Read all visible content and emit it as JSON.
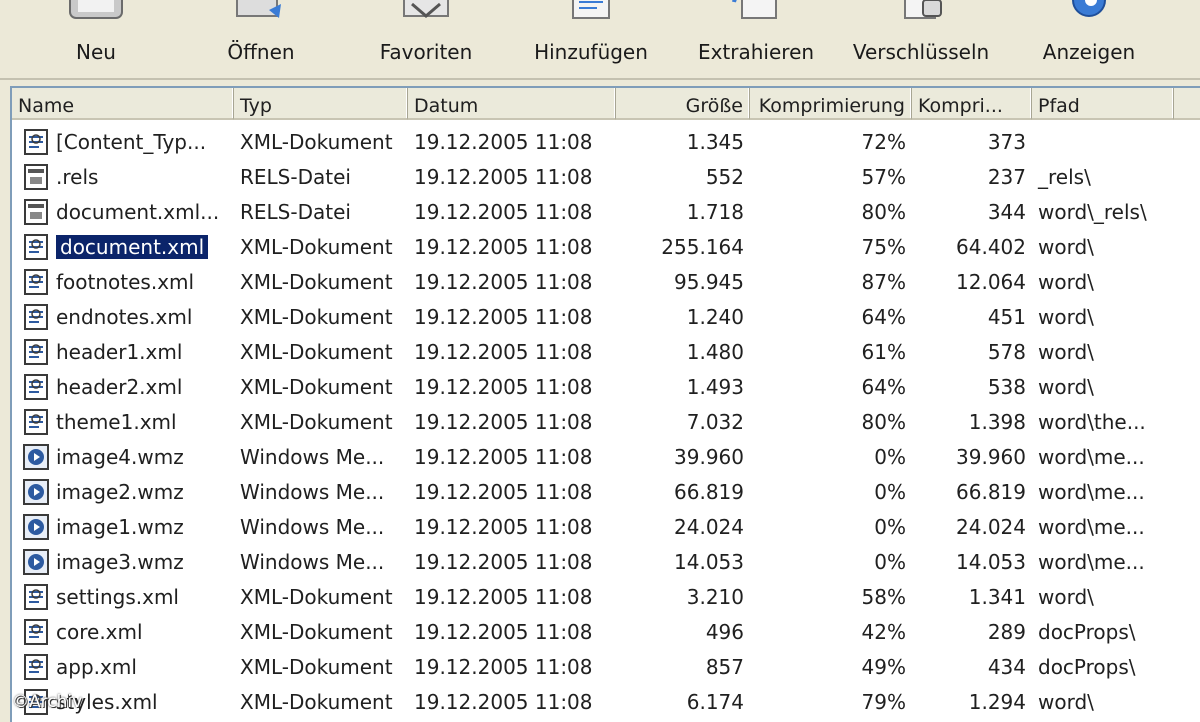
{
  "toolbar": {
    "buttons": [
      {
        "label": "Neu",
        "icon": "new-archive-icon"
      },
      {
        "label": "Öffnen",
        "icon": "open-archive-icon"
      },
      {
        "label": "Favoriten",
        "icon": "favorites-icon"
      },
      {
        "label": "Hinzufügen",
        "icon": "add-files-icon"
      },
      {
        "label": "Extrahieren",
        "icon": "extract-icon"
      },
      {
        "label": "Verschlüsseln",
        "icon": "encrypt-lock-icon"
      },
      {
        "label": "Anzeigen",
        "icon": "view-icon"
      }
    ]
  },
  "columns": {
    "name": "Name",
    "type": "Typ",
    "date": "Datum",
    "size": "Größe",
    "ratio": "Komprimierung",
    "packed": "Kompri...",
    "path": "Pfad"
  },
  "rows": [
    {
      "name": "[Content_Typ...",
      "type": "XML-Dokument",
      "date": "19.12.2005 11:08",
      "size": "1.345",
      "ratio": "72%",
      "packed": "373",
      "path": "",
      "icon": "xml-file-icon"
    },
    {
      "name": ".rels",
      "type": "RELS-Datei",
      "date": "19.12.2005 11:08",
      "size": "552",
      "ratio": "57%",
      "packed": "237",
      "path": "_rels\\",
      "icon": "rels-file-icon"
    },
    {
      "name": "document.xml...",
      "type": "RELS-Datei",
      "date": "19.12.2005 11:08",
      "size": "1.718",
      "ratio": "80%",
      "packed": "344",
      "path": "word\\_rels\\",
      "icon": "rels-file-icon"
    },
    {
      "name": "document.xml",
      "type": "XML-Dokument",
      "date": "19.12.2005 11:08",
      "size": "255.164",
      "ratio": "75%",
      "packed": "64.402",
      "path": "word\\",
      "icon": "xml-file-icon",
      "selected": true
    },
    {
      "name": "footnotes.xml",
      "type": "XML-Dokument",
      "date": "19.12.2005 11:08",
      "size": "95.945",
      "ratio": "87%",
      "packed": "12.064",
      "path": "word\\",
      "icon": "xml-file-icon"
    },
    {
      "name": "endnotes.xml",
      "type": "XML-Dokument",
      "date": "19.12.2005 11:08",
      "size": "1.240",
      "ratio": "64%",
      "packed": "451",
      "path": "word\\",
      "icon": "xml-file-icon"
    },
    {
      "name": "header1.xml",
      "type": "XML-Dokument",
      "date": "19.12.2005 11:08",
      "size": "1.480",
      "ratio": "61%",
      "packed": "578",
      "path": "word\\",
      "icon": "xml-file-icon"
    },
    {
      "name": "header2.xml",
      "type": "XML-Dokument",
      "date": "19.12.2005 11:08",
      "size": "1.493",
      "ratio": "64%",
      "packed": "538",
      "path": "word\\",
      "icon": "xml-file-icon"
    },
    {
      "name": "theme1.xml",
      "type": "XML-Dokument",
      "date": "19.12.2005 11:08",
      "size": "7.032",
      "ratio": "80%",
      "packed": "1.398",
      "path": "word\\the...",
      "icon": "xml-file-icon"
    },
    {
      "name": "image4.wmz",
      "type": "Windows Me...",
      "date": "19.12.2005 11:08",
      "size": "39.960",
      "ratio": "0%",
      "packed": "39.960",
      "path": "word\\me...",
      "icon": "media-file-icon"
    },
    {
      "name": "image2.wmz",
      "type": "Windows Me...",
      "date": "19.12.2005 11:08",
      "size": "66.819",
      "ratio": "0%",
      "packed": "66.819",
      "path": "word\\me...",
      "icon": "media-file-icon"
    },
    {
      "name": "image1.wmz",
      "type": "Windows Me...",
      "date": "19.12.2005 11:08",
      "size": "24.024",
      "ratio": "0%",
      "packed": "24.024",
      "path": "word\\me...",
      "icon": "media-file-icon"
    },
    {
      "name": "image3.wmz",
      "type": "Windows Me...",
      "date": "19.12.2005 11:08",
      "size": "14.053",
      "ratio": "0%",
      "packed": "14.053",
      "path": "word\\me...",
      "icon": "media-file-icon"
    },
    {
      "name": "settings.xml",
      "type": "XML-Dokument",
      "date": "19.12.2005 11:08",
      "size": "3.210",
      "ratio": "58%",
      "packed": "1.341",
      "path": "word\\",
      "icon": "xml-file-icon"
    },
    {
      "name": "core.xml",
      "type": "XML-Dokument",
      "date": "19.12.2005 11:08",
      "size": "496",
      "ratio": "42%",
      "packed": "289",
      "path": "docProps\\",
      "icon": "xml-file-icon"
    },
    {
      "name": "app.xml",
      "type": "XML-Dokument",
      "date": "19.12.2005 11:08",
      "size": "857",
      "ratio": "49%",
      "packed": "434",
      "path": "docProps\\",
      "icon": "xml-file-icon"
    },
    {
      "name": "styles.xml",
      "type": "XML-Dokument",
      "date": "19.12.2005 11:08",
      "size": "6.174",
      "ratio": "79%",
      "packed": "1.294",
      "path": "word\\",
      "icon": "xml-file-icon"
    }
  ],
  "watermark": "©Archiv",
  "colors": {
    "selection": "#0b246a",
    "background": "#ece9d8",
    "header": "#ebeadb"
  }
}
